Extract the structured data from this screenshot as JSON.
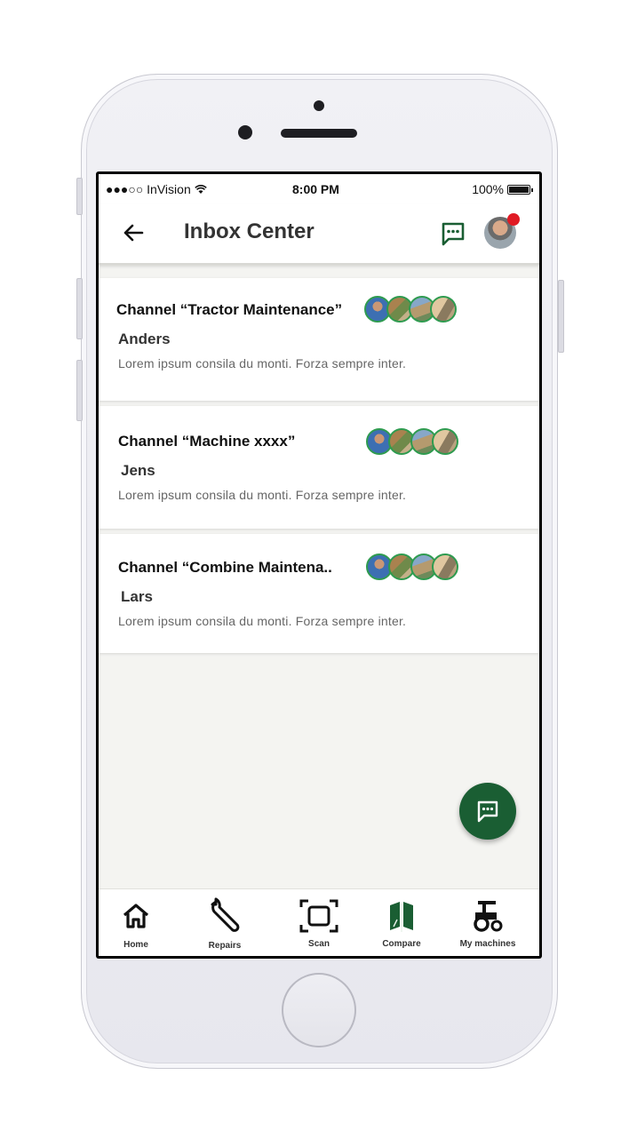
{
  "status_bar": {
    "carrier": "●●●○○ InVision",
    "time": "8:00 PM",
    "battery": "100%"
  },
  "header": {
    "title": "Inbox Center"
  },
  "channels": [
    {
      "channel": "Channel “Tractor Maintenance”",
      "name": "Anders",
      "message": "Lorem ipsum consila du monti. Forza sempre inter."
    },
    {
      "channel": "Channel “Machine xxxx”",
      "name": "Jens",
      "message": "Lorem ipsum consila du monti. Forza sempre inter."
    },
    {
      "channel": "Channel “Combine Maintena..",
      "name": "Lars",
      "message": "Lorem ipsum consila du monti. Forza sempre inter."
    }
  ],
  "tabs": [
    {
      "label": "Home",
      "icon": "home-icon"
    },
    {
      "label": "Repairs",
      "icon": "wrench-icon"
    },
    {
      "label": "Scan",
      "icon": "scan-icon"
    },
    {
      "label": "Compare",
      "icon": "compare-icon"
    },
    {
      "label": "My machines",
      "icon": "tractor-icon"
    }
  ],
  "colors": {
    "accent": "#1a5e33",
    "avatar_ring": "#2e9b4f",
    "notification": "#e01b24",
    "background": "#f4f4f1"
  }
}
